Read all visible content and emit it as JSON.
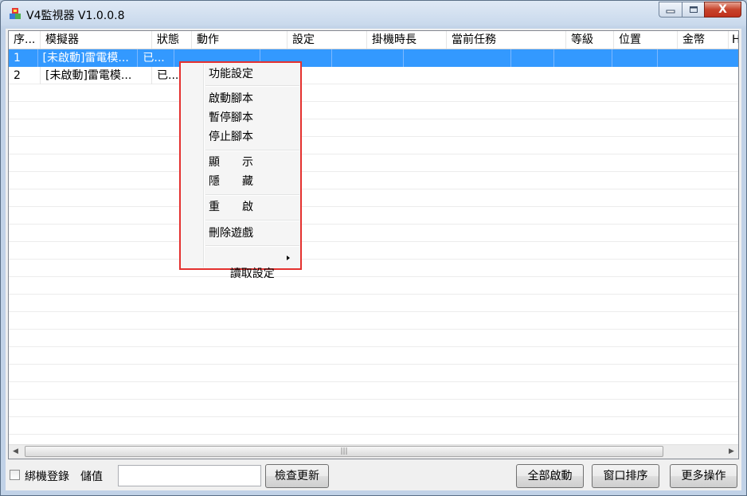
{
  "window": {
    "title": "V4監視器 V1.0.0.8",
    "close_glyph": "X"
  },
  "table": {
    "columns": [
      "序...",
      "模擬器",
      "狀態",
      "動作",
      "設定",
      "掛機時長",
      "當前任務",
      "等級",
      "位置",
      "金幣",
      "H"
    ],
    "rows": [
      {
        "index": "1",
        "emulator": "[未啟動]雷電模...",
        "status": "已...",
        "selected": true
      },
      {
        "index": "2",
        "emulator": "[未啟動]雷電模...",
        "status": "已...",
        "selected": false
      }
    ],
    "scroll_grip": "|||"
  },
  "context_menu": {
    "items": [
      "功能設定",
      "啟動腳本",
      "暫停腳本",
      "停止腳本",
      "顯　　示",
      "隱　　藏",
      "重　　啟",
      "刪除遊戲",
      "讀取設定"
    ]
  },
  "bottom": {
    "bind_login_label": "綁機登錄",
    "value_label": "儲值",
    "value_input": "",
    "check_update": "檢查更新",
    "start_all": "全部啟動",
    "arrange_windows": "窗口排序",
    "more_actions": "更多操作"
  },
  "colors": {
    "selection": "#3399ff",
    "highlight_border": "#e4312f",
    "close_button": "#c7432b"
  }
}
